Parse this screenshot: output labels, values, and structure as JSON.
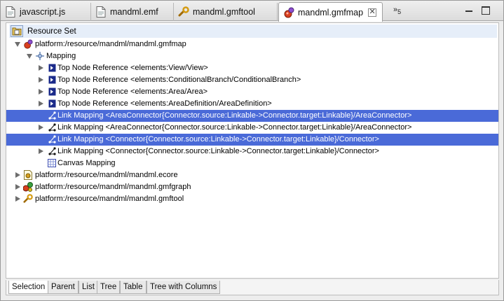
{
  "tabs": [
    {
      "label": "javascript.js",
      "icon": "javascript-file-icon"
    },
    {
      "label": "mandml.emf",
      "icon": "emf-file-icon"
    },
    {
      "label": "mandml.gmftool",
      "icon": "gmftool-file-icon"
    },
    {
      "label": "mandml.gmfmap",
      "icon": "gmfmap-file-icon",
      "active": true,
      "close": "✕"
    }
  ],
  "overflow": {
    "symbol": "»",
    "count": "5"
  },
  "resource_set": {
    "label": "Resource Set"
  },
  "tree": [
    {
      "label": "platform:/resource/mandml/mandml.gmfmap",
      "icon": "gmfmap-file-icon",
      "expanded": true
    },
    {
      "label": "Mapping",
      "icon": "mapping-icon",
      "expanded": true
    },
    {
      "label": "Top Node Reference <elements:View/View>",
      "icon": "top-node-reference-icon"
    },
    {
      "label": "Top Node Reference <elements:ConditionalBranch/ConditionalBranch>",
      "icon": "top-node-reference-icon"
    },
    {
      "label": "Top Node Reference <elements:Area/Area>",
      "icon": "top-node-reference-icon"
    },
    {
      "label": "Top Node Reference <elements:AreaDefinition/AreaDefinition>",
      "icon": "top-node-reference-icon"
    },
    {
      "label": "Link Mapping <AreaConnector{Connector.source:Linkable->Connector.target:Linkable}/AreaConnector>",
      "icon": "link-mapping-icon",
      "selected": true
    },
    {
      "label": "Link Mapping <AreaConnector{Connector.source:Linkable->Connector.target:Linkable}/AreaConnector>",
      "icon": "link-mapping-icon"
    },
    {
      "label": "Link Mapping <Connector{Connector.source:Linkable->Connector.target:Linkable}/Connector>",
      "icon": "link-mapping-icon",
      "selected": true
    },
    {
      "label": "Link Mapping <Connector{Connector.source:Linkable->Connector.target:Linkable}/Connector>",
      "icon": "link-mapping-icon"
    },
    {
      "label": "Canvas Mapping",
      "icon": "canvas-mapping-icon"
    },
    {
      "label": "platform:/resource/mandml/mandml.ecore",
      "icon": "ecore-file-icon"
    },
    {
      "label": "platform:/resource/mandml/mandml.gmfgraph",
      "icon": "gmfgraph-file-icon"
    },
    {
      "label": "platform:/resource/mandml/mandml.gmftool",
      "icon": "gmftool-file-icon"
    }
  ],
  "bottom_tabs": [
    "Selection",
    "Parent",
    "List",
    "Tree",
    "Table",
    "Tree with Columns"
  ],
  "colors": {
    "selection": "#4a6ad8",
    "resource_set_bg": "#e6eef9"
  }
}
